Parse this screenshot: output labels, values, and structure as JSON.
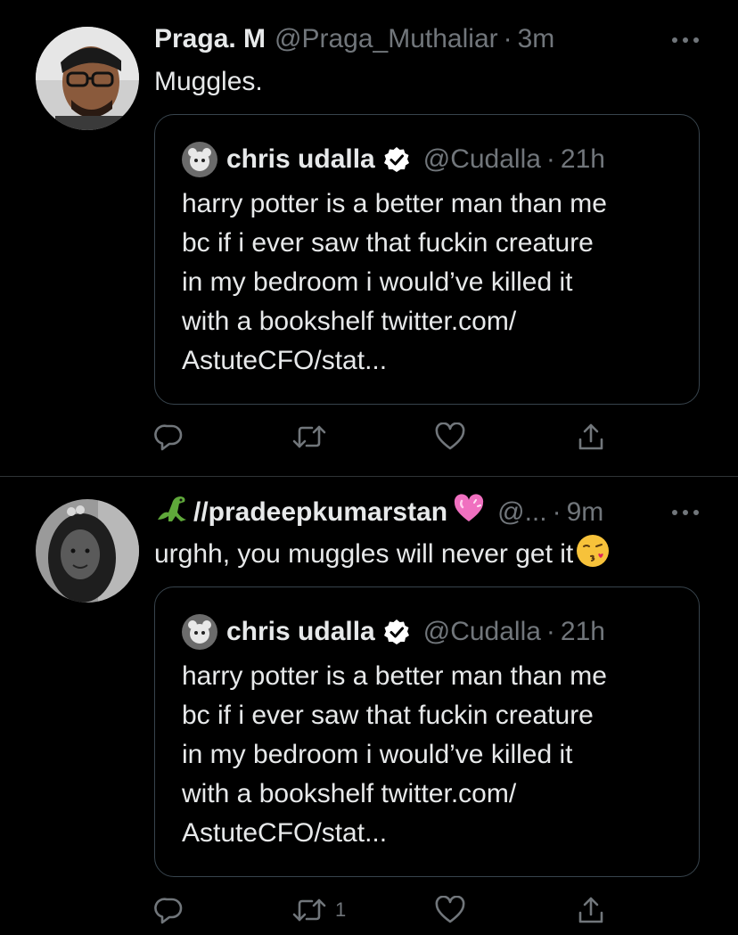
{
  "colors": {
    "background": "#000000",
    "text_primary": "#e7e9ea",
    "text_secondary": "#71767b",
    "border": "#38444d",
    "verified_badge": "#ffffff",
    "heart_emoji": "#f070c0"
  },
  "tweets": [
    {
      "author_name": "Praga. M",
      "handle": "@Praga_Muthaliar",
      "separator": "·",
      "time": "3m",
      "text": "Muggles.",
      "avatar_icon": "man-with-glasses-avatar",
      "quote": {
        "author_name": "chris udalla",
        "handle": "@Cudalla",
        "separator": "·",
        "time": "21h",
        "verified": true,
        "lines": [
          "harry potter is a better man than me",
          "bc if i ever saw that fuckin creature",
          "in my bedroom i would’ve killed it",
          "with a bookshelf twitter.com/",
          "AstuteCFO/stat..."
        ]
      },
      "actions": {
        "reply_count": "",
        "retweet_count": "",
        "like_count": ""
      }
    },
    {
      "author_name": "//pradeepkumarstan",
      "name_prefix_emoji": "dinosaur-emoji",
      "name_suffix_emoji": "pink-heart-emoji",
      "handle": "@...",
      "separator": "·",
      "time": "9m",
      "text": "urghh, you muggles will never get it",
      "text_suffix_emoji": "kissing-face-emoji",
      "avatar_icon": "woman-avatar",
      "quote": {
        "author_name": "chris udalla",
        "handle": "@Cudalla",
        "separator": "·",
        "time": "21h",
        "verified": true,
        "lines": [
          "harry potter is a better man than me",
          "bc if i ever saw that fuckin creature",
          "in my bedroom i would’ve killed it",
          "with a bookshelf twitter.com/",
          "AstuteCFO/stat..."
        ]
      },
      "actions": {
        "reply_count": "",
        "retweet_count": "1",
        "like_count": ""
      }
    }
  ]
}
